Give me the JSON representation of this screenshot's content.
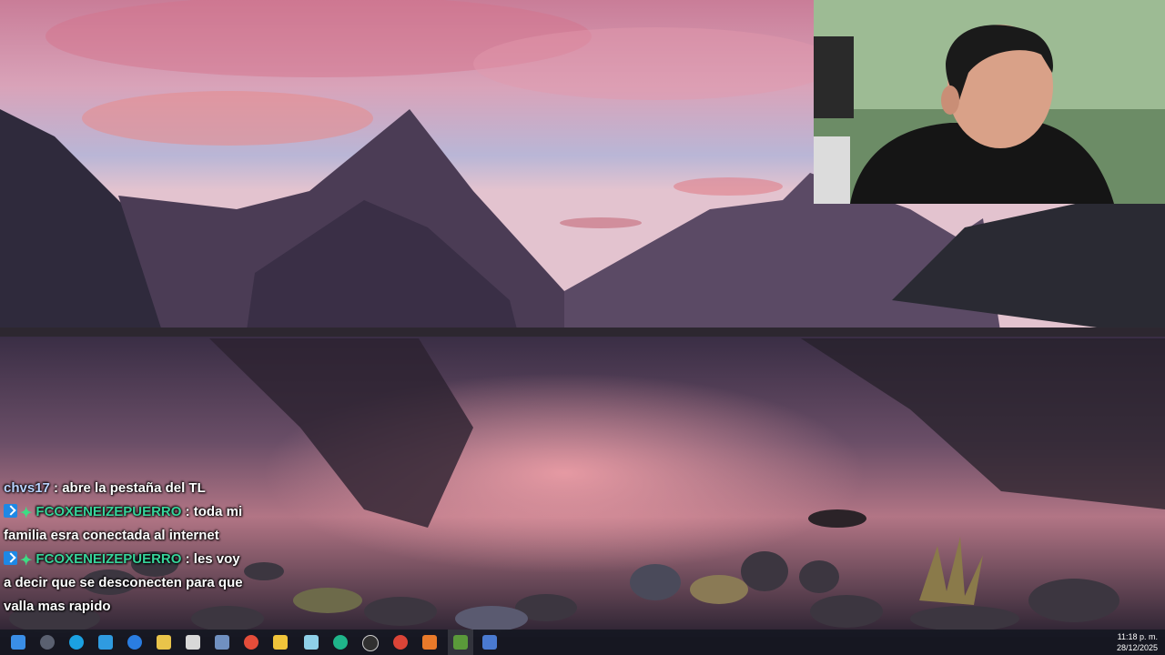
{
  "chat": {
    "messages": [
      {
        "user": "chvs17",
        "text": ": abre la pestaña del TL",
        "user_color": "#b9d3ff",
        "badges": []
      },
      {
        "user": "FCOXENEIZEPUERRO",
        "text": ": toda mi familia esra conectada al internet",
        "user_color": "#37d49a",
        "badges": [
          "prime-arrow-icon",
          "gem-icon"
        ]
      },
      {
        "user": "FCOXENEIZEPUERRO",
        "text": ": les voy a decir que se desconecten para que valla mas rapido",
        "user_color": "#37d49a",
        "badges": [
          "prime-arrow-icon",
          "gem-icon"
        ]
      }
    ]
  },
  "taskbar": {
    "icons": [
      "windows-icon",
      "search-icon",
      "edge-icon",
      "task-view-icon",
      "chrome-icon",
      "file-explorer-icon",
      "notepad-icon",
      "app-icon",
      "obs-icon",
      "chrome-icon",
      "java-icon",
      "minecraft-icon",
      "launcher-icon"
    ],
    "time": "11:18 p. m.",
    "date": "28/12/2025"
  }
}
